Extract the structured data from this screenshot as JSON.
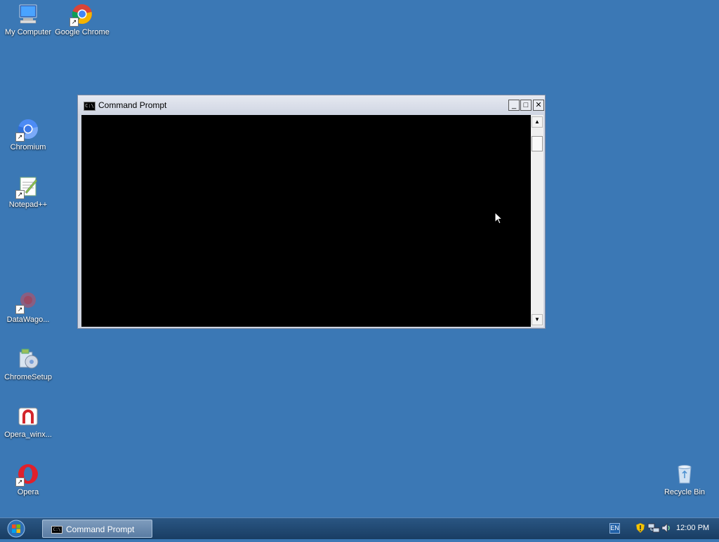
{
  "desktop": {
    "icons": [
      {
        "label": "My Computer"
      },
      {
        "label": "Google Chrome"
      },
      {
        "label": "Chromium"
      },
      {
        "label": "Notepad++"
      },
      {
        "label": "DataWago..."
      },
      {
        "label": "ChromeSetup"
      },
      {
        "label": "Opera_winx..."
      },
      {
        "label": "Opera"
      },
      {
        "label": "Recycle Bin"
      }
    ],
    "background_color": "#3b78b5"
  },
  "window": {
    "title": "Command Prompt",
    "icon": "cmd-icon",
    "icon_text": "C:\\",
    "minimize_glyph": "_",
    "maximize_glyph": "□",
    "close_glyph": "✕",
    "console_background": "#000000",
    "scroll_up_glyph": "▲",
    "scroll_down_glyph": "▼"
  },
  "taskbar": {
    "task_button_label": "Command Prompt",
    "language": "EN",
    "clock": "12:00 PM"
  }
}
